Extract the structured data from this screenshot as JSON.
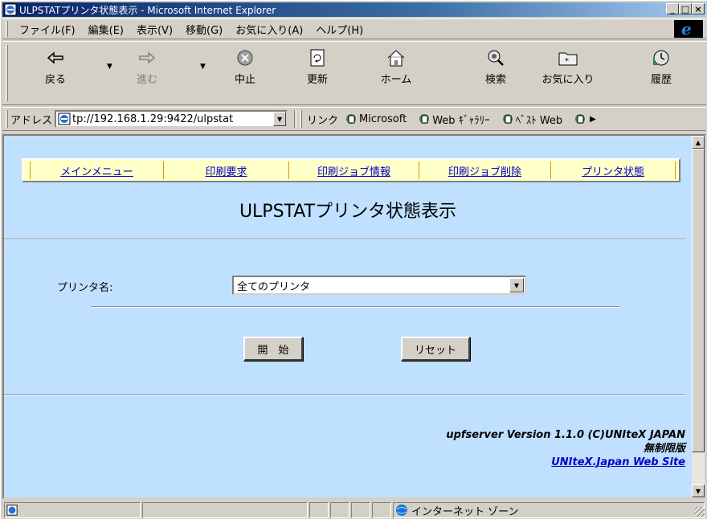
{
  "window": {
    "title": "ULPSTATプリンタ状態表示 - Microsoft Internet Explorer",
    "buttons": {
      "minimize": "_",
      "maximize": "□",
      "close": "×"
    }
  },
  "menubar": {
    "items": [
      "ファイル(F)",
      "編集(E)",
      "表示(V)",
      "移動(G)",
      "お気に入り(A)",
      "ヘルプ(H)"
    ]
  },
  "toolbar": {
    "back": "戻る",
    "forward": "進む",
    "stop": "中止",
    "refresh": "更新",
    "home": "ホーム",
    "search": "検索",
    "favorites": "お気に入り",
    "history": "履歴"
  },
  "addressbar": {
    "label": "アドレス",
    "url": "tp://192.168.1.29:9422/ulpstat",
    "links_label": "リンク",
    "links": [
      "Microsoft",
      "Web ｷﾞｬﾗﾘｰ",
      "ﾍﾞｽﾄ Web"
    ]
  },
  "nav": {
    "items": [
      "メインメニュー",
      "印刷要求",
      "印刷ジョブ情報",
      "印刷ジョブ削除",
      "プリンタ状態"
    ]
  },
  "page": {
    "title": "ULPSTATプリンタ状態表示",
    "printer_label": "プリンタ名:",
    "printer_selected": "全てのプリンタ",
    "start_button": "開　始",
    "reset_button": "リセット"
  },
  "footer": {
    "version": "upfserver Version 1.1.0 (C)UNIteX JAPAN",
    "license": "無制限版",
    "link": "UNIteX.Japan Web Site"
  },
  "statusbar": {
    "zone": "インターネット ゾーン"
  },
  "colors": {
    "content_bg": "#c0e0ff",
    "nav_bg": "#ffffc8",
    "link": "#0000cc",
    "titlebar": "#0a246a"
  }
}
